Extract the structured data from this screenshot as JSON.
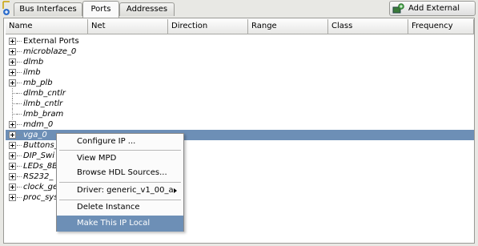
{
  "tabs": [
    {
      "label": "Bus Interfaces"
    },
    {
      "label": "Ports"
    },
    {
      "label": "Addresses"
    }
  ],
  "add_external_port_label": "Add External Port",
  "columns": [
    "Name",
    "Net",
    "Direction",
    "Range",
    "Class",
    "Frequency"
  ],
  "rows": [
    {
      "name": "External Ports"
    },
    {
      "name": "microblaze_0"
    },
    {
      "name": "dlmb"
    },
    {
      "name": "ilmb"
    },
    {
      "name": "mb_plb"
    },
    {
      "name": "dlmb_cntlr"
    },
    {
      "name": "ilmb_cntlr"
    },
    {
      "name": "lmb_bram"
    },
    {
      "name": "mdm_0"
    },
    {
      "name": "vga_0"
    },
    {
      "name": "Buttons_"
    },
    {
      "name": "DIP_Swi"
    },
    {
      "name": "LEDs_8B"
    },
    {
      "name": "RS232_"
    },
    {
      "name": "clock_ge"
    },
    {
      "name": "proc_sys"
    }
  ],
  "context_menu": {
    "configure": "Configure IP ...",
    "view_mpd": "View MPD",
    "browse_hdl": "Browse HDL Sources...",
    "driver": "Driver: generic_v1_00_a",
    "delete": "Delete Instance",
    "make_local": "Make This IP Local"
  },
  "colors": {
    "selection": "#6d8fb6"
  }
}
